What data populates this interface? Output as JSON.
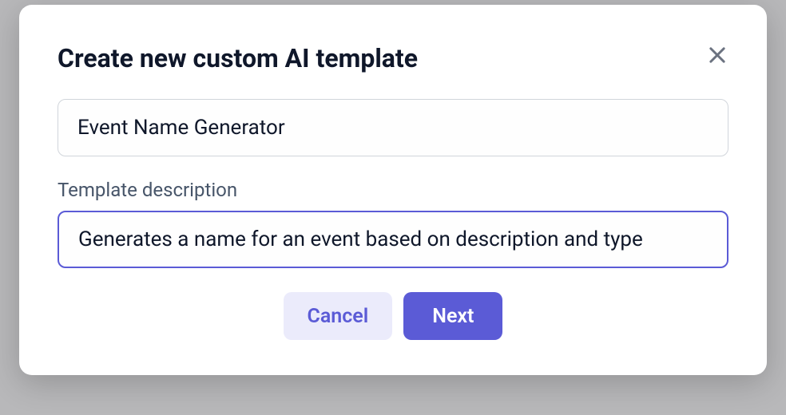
{
  "modal": {
    "title": "Create new custom AI template",
    "name_field": {
      "value": "Event Name Generator"
    },
    "description_field": {
      "label": "Template description",
      "value": "Generates a name for an event based on description and type"
    },
    "buttons": {
      "cancel": "Cancel",
      "next": "Next"
    }
  }
}
